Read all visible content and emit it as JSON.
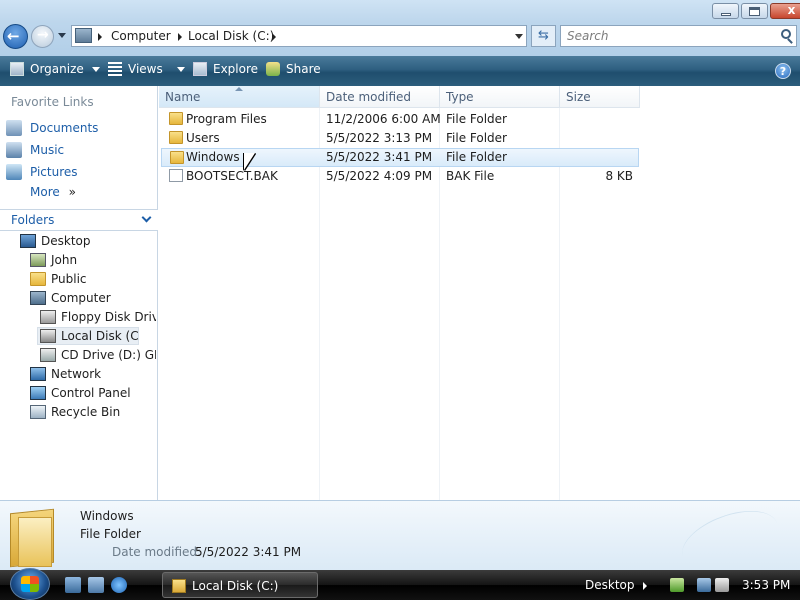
{
  "address": {
    "crumbs": [
      "Computer",
      "Local Disk (C:)"
    ],
    "search_placeholder": "Search"
  },
  "toolbar": {
    "organize": "Organize",
    "views": "Views",
    "explore": "Explore",
    "share": "Share",
    "help": "?"
  },
  "sidebar": {
    "favorites_title": "Favorite Links",
    "favorites": [
      "Documents",
      "Music",
      "Pictures"
    ],
    "more": "More",
    "folders_title": "Folders",
    "tree": [
      "Desktop",
      "John",
      "Public",
      "Computer",
      "Floppy Disk Drive",
      "Local Disk (C:)",
      "CD Drive (D:) GRMCULFRER_EN_DVD",
      "Network",
      "Control Panel",
      "Recycle Bin"
    ]
  },
  "list": {
    "columns": [
      "Name",
      "Date modified",
      "Type",
      "Size"
    ],
    "rows": [
      {
        "name": "Program Files",
        "date": "11/2/2006 6:00 AM",
        "type": "File Folder",
        "size": ""
      },
      {
        "name": "Users",
        "date": "5/5/2022 3:13 PM",
        "type": "File Folder",
        "size": ""
      },
      {
        "name": "Windows",
        "date": "5/5/2022 3:41 PM",
        "type": "File Folder",
        "size": ""
      },
      {
        "name": "BOOTSECT.BAK",
        "date": "5/5/2022 4:09 PM",
        "type": "BAK File",
        "size": "8 KB"
      }
    ],
    "selected_index": 2
  },
  "details": {
    "name": "Windows",
    "type": "File Folder",
    "modified_label": "Date modified:",
    "modified_value": "5/5/2022 3:41 PM"
  },
  "taskbar": {
    "window_button": "Local Disk (C:)",
    "desktop_label": "Desktop",
    "clock": "3:53 PM"
  },
  "colors": {
    "link_blue": "#1d5ea8",
    "command_bar": "#2e5f80",
    "selection": "#d9ebfa"
  }
}
